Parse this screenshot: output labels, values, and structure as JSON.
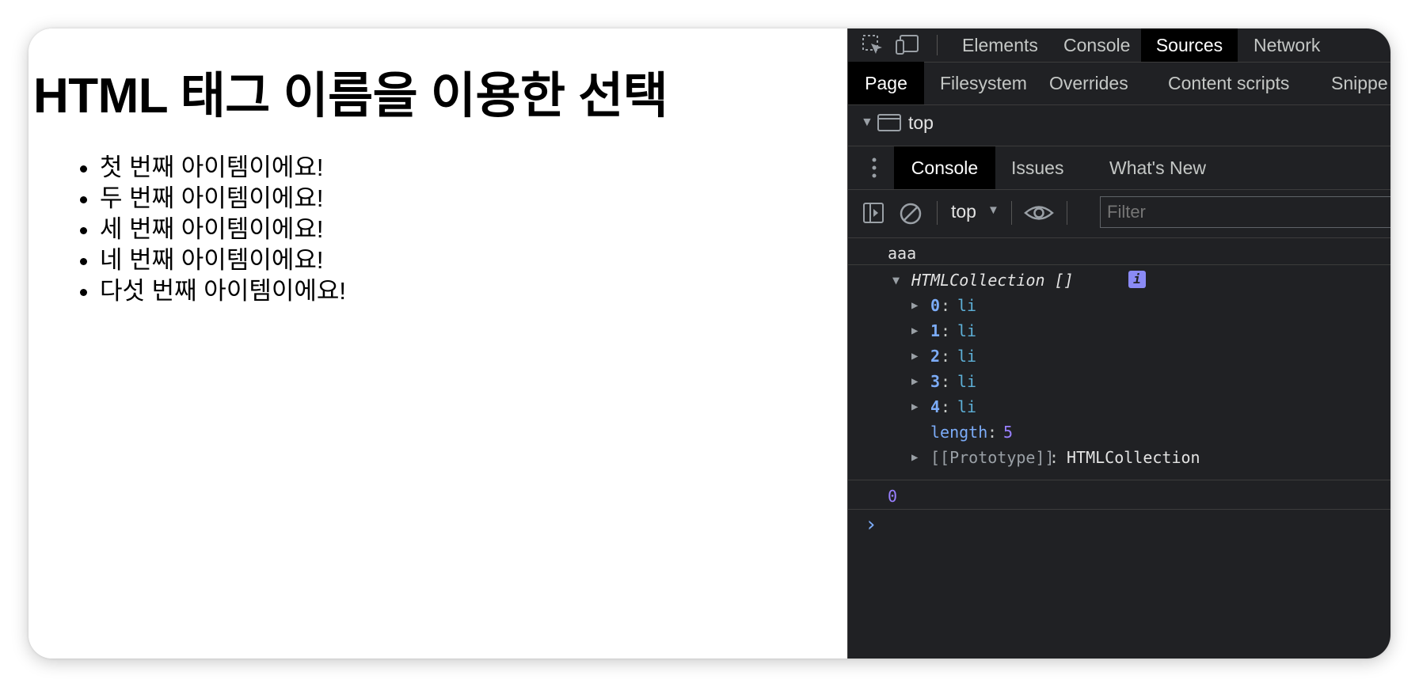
{
  "page": {
    "heading": "HTML 태그 이름을 이용한 선택",
    "items": [
      "첫 번째 아이템이에요!",
      "두 번째 아이템이에요!",
      "세 번째 아이템이에요!",
      "네 번째 아이템이에요!",
      "다섯 번째 아이템이에요!"
    ]
  },
  "devtools": {
    "main_tabs": [
      "Elements",
      "Console",
      "Sources",
      "Network"
    ],
    "active_main_tab": "Sources",
    "sub_tabs": [
      "Page",
      "Filesystem",
      "Overrides",
      "Content scripts",
      "Snippe"
    ],
    "active_sub_tab": "Page",
    "tree_root": "top",
    "drawer_tabs": [
      "Console",
      "Issues",
      "What's New"
    ],
    "active_drawer_tab": "Console",
    "context": "top",
    "filter_placeholder": "Filter",
    "console": {
      "log1": "aaa",
      "collection_label": "HTMLCollection []",
      "entries": [
        {
          "index": "0",
          "tag": "li"
        },
        {
          "index": "1",
          "tag": "li"
        },
        {
          "index": "2",
          "tag": "li"
        },
        {
          "index": "3",
          "tag": "li"
        },
        {
          "index": "4",
          "tag": "li"
        }
      ],
      "length_key": "length",
      "length_value": "5",
      "prototype_key": "[[Prototype]]",
      "prototype_value": "HTMLCollection",
      "result": "0",
      "prompt": "›"
    }
  },
  "colors": {
    "devtools_bg": "#202124",
    "active_tab_bg": "#000000",
    "key_blue": "#7cacf8",
    "number_purple": "#9980ff",
    "info_badge": "#8a8af5"
  },
  "icons": [
    "inspect-element-icon",
    "device-toolbar-icon",
    "more-vert-icon",
    "sidebar-toggle-icon",
    "clear-console-icon",
    "eye-icon",
    "info-icon",
    "frame-icon"
  ]
}
